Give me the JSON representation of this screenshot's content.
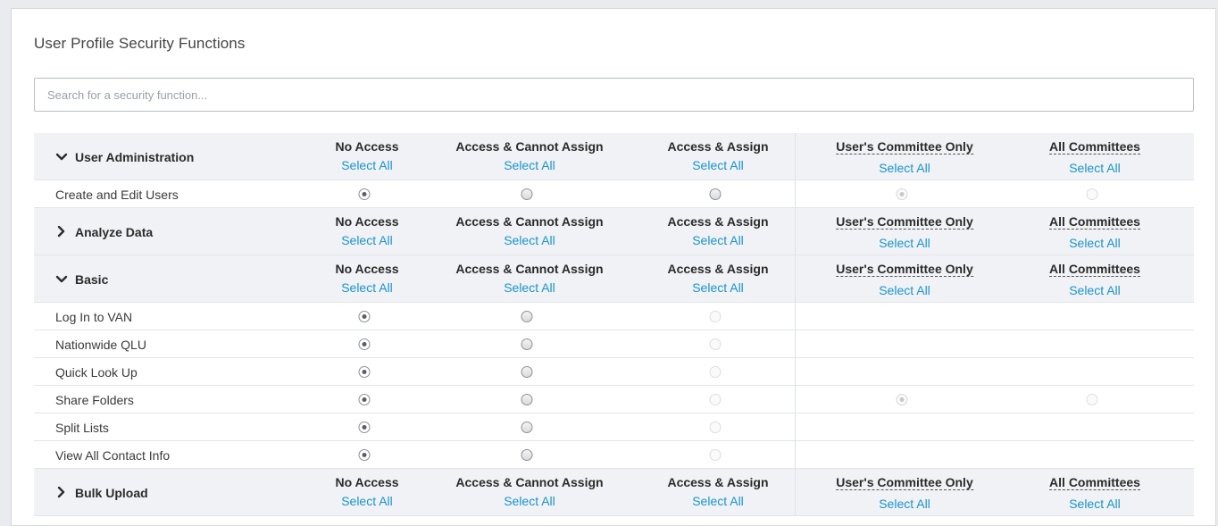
{
  "page": {
    "title": "User Profile Security Functions",
    "search_placeholder": "Search for a security function..."
  },
  "columns": {
    "no_access": "No Access",
    "access_cannot_assign": "Access & Cannot Assign",
    "access_assign": "Access & Assign",
    "users_committee_only": "User's Committee Only",
    "all_committees": "All Committees",
    "select_all": "Select All"
  },
  "sections": [
    {
      "name": "User Administration",
      "expanded": true,
      "items": [
        {
          "label": "Create and Edit Users",
          "radios": [
            "on",
            "off",
            "off",
            "dis-on",
            "dis-off"
          ]
        }
      ]
    },
    {
      "name": "Analyze Data",
      "expanded": false,
      "items": []
    },
    {
      "name": "Basic",
      "expanded": true,
      "items": [
        {
          "label": "Log In to VAN",
          "radios": [
            "on",
            "off",
            "dis-off",
            null,
            null
          ]
        },
        {
          "label": "Nationwide QLU",
          "radios": [
            "on",
            "off",
            "dis-off",
            null,
            null
          ]
        },
        {
          "label": "Quick Look Up",
          "radios": [
            "on",
            "off",
            "dis-off",
            null,
            null
          ]
        },
        {
          "label": "Share Folders",
          "radios": [
            "on",
            "off",
            "dis-off",
            "dis-on",
            "dis-off"
          ]
        },
        {
          "label": "Split Lists",
          "radios": [
            "on",
            "off",
            "dis-off",
            null,
            null
          ]
        },
        {
          "label": "View All Contact Info",
          "radios": [
            "on",
            "off",
            "dis-off",
            null,
            null
          ]
        }
      ]
    },
    {
      "name": "Bulk Upload",
      "expanded": false,
      "items": []
    }
  ],
  "icons": {
    "expanded": "chevron-down-icon",
    "collapsed": "chevron-right-icon"
  },
  "colors": {
    "link": "#1a93d2",
    "header_bg": "#f0f2f5"
  }
}
